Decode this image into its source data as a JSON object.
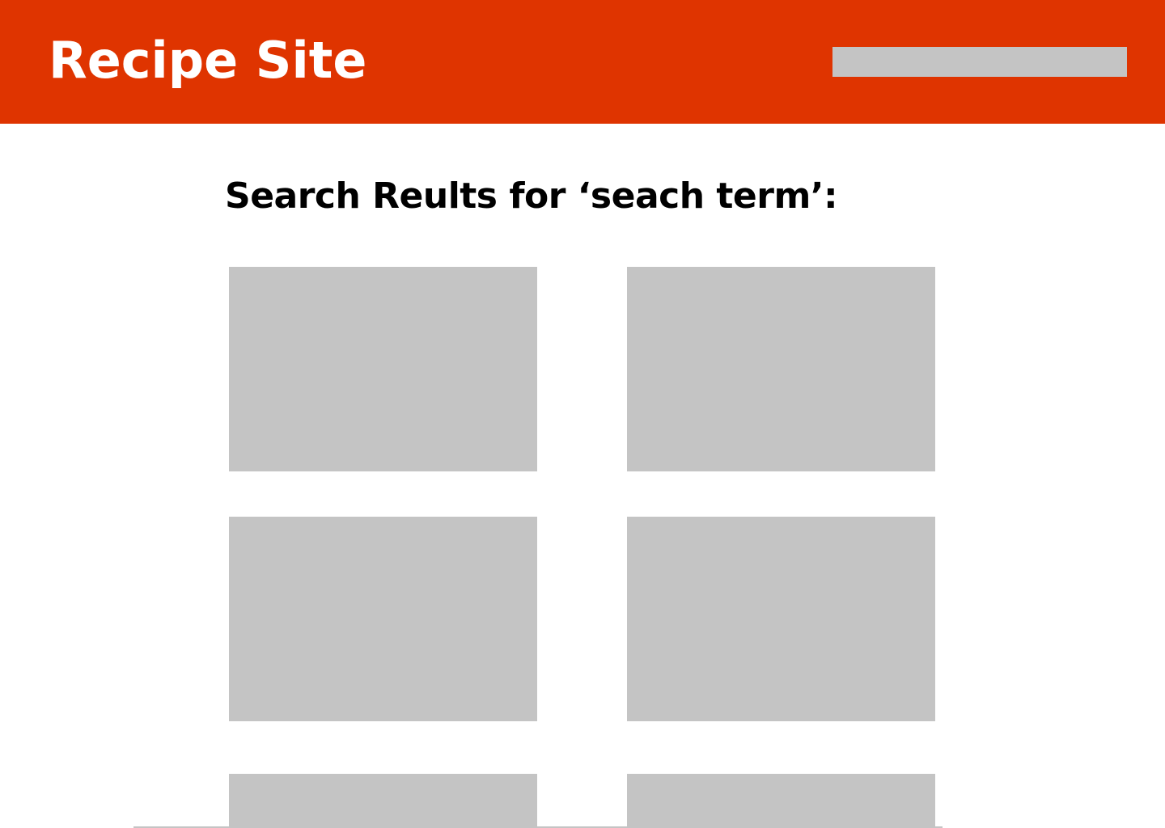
{
  "colors": {
    "header_background": "#df3400",
    "placeholder_gray": "#c4c4c4",
    "title_text": "#ffffff",
    "heading_text": "#000000"
  },
  "header": {
    "site_title": "Recipe Site",
    "search": {
      "value": "",
      "placeholder": ""
    }
  },
  "main": {
    "results_heading": "Search Reults for ‘seach term’:",
    "result_cards": [
      {
        "name": "result-card-1",
        "image": "placeholder"
      },
      {
        "name": "result-card-2",
        "image": "placeholder"
      },
      {
        "name": "result-card-3",
        "image": "placeholder"
      },
      {
        "name": "result-card-4",
        "image": "placeholder"
      },
      {
        "name": "result-card-5",
        "image": "placeholder"
      },
      {
        "name": "result-card-6",
        "image": "placeholder"
      }
    ]
  }
}
